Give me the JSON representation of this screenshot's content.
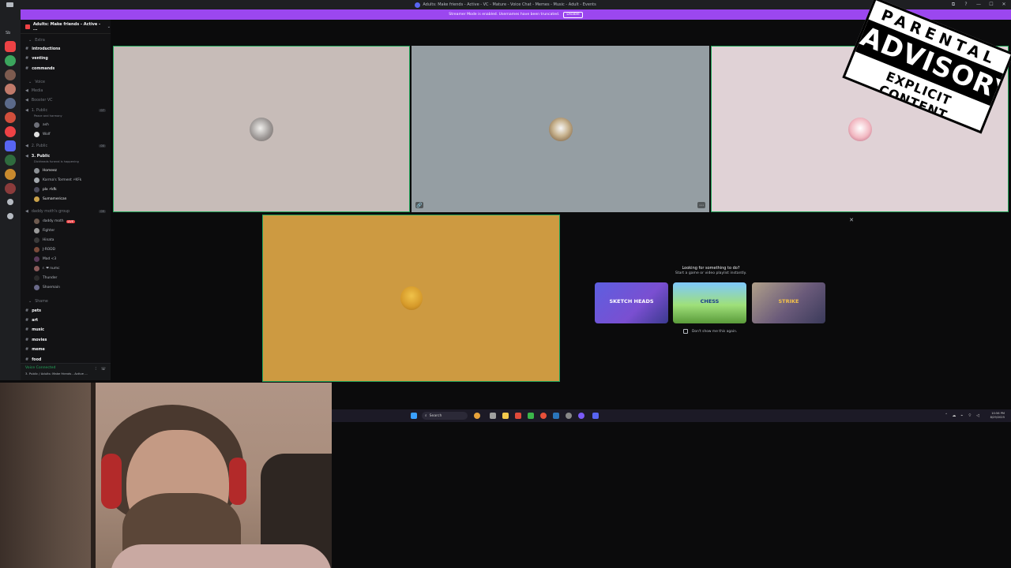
{
  "window": {
    "title": "Adults: Make friends - Active - VC - Mature - Voice Chat - Memes - Music - Adult - Events",
    "controls": [
      "⧉",
      "?",
      "—",
      "☐",
      "✕"
    ]
  },
  "banner": {
    "text": "Streamer Mode is enabled. Usernames have been truncated.",
    "disable_label": "Disable"
  },
  "rail": {
    "label": "Sb"
  },
  "server": {
    "name": "Adults: Make friends - Active - ...",
    "channels_top": [
      {
        "label": "Extra",
        "type": "category"
      },
      {
        "label": "introductions",
        "type": "text",
        "bright": true
      },
      {
        "label": "venting",
        "type": "text",
        "bright": true
      },
      {
        "label": "commands",
        "type": "text",
        "bright": true
      },
      {
        "label": "Voice",
        "type": "category"
      },
      {
        "label": "Media",
        "type": "voice"
      },
      {
        "label": "Booster VC",
        "type": "voice"
      },
      {
        "label": "1. Public",
        "type": "voice"
      }
    ],
    "public1_topic": "Peace and harmony",
    "public1_users": [
      "ash",
      "Wolf"
    ],
    "public2": "2. Public",
    "public3": "3. Public",
    "public3_topic": "Dickheads funeral is happening",
    "public3_users": [
      "Homeez",
      "Karma's Torment ⚡KFk",
      "plx ⚡kfk",
      "Sumamerican"
    ],
    "daddy_group": "daddy moth's group",
    "daddy_users": [
      "daddy moth",
      "Fighter",
      "Hinata",
      "J-RODD",
      "Mad <3",
      "r. ❤ numc",
      "Thunder",
      "Shoemain"
    ],
    "live_label": "LIVE",
    "shame_category": "Shame",
    "text_channels": [
      "pets",
      "art",
      "music",
      "movies",
      "meme",
      "food"
    ],
    "counts": {
      "public1": "07",
      "public2": "00",
      "daddy": "09"
    },
    "voice_status": "Voice Connected",
    "voice_sub": "3. Public / Adults: Make friends - Active ..."
  },
  "tiles": {
    "corner_icon_left": "🔗",
    "corner_icon_right": "⋯"
  },
  "activity": {
    "title": "Looking for something to do?",
    "subtitle": "Start a game or video playlist instantly.",
    "games": [
      "SKETCH HEADS",
      "CHESS",
      "STRIKE"
    ],
    "dont_show": "Don't show me this again."
  },
  "sticker": {
    "line1": "PARENTAL",
    "line2": "ADVISORY",
    "line3": "EXPLICIT CONTENT"
  },
  "taskbar": {
    "search_label": "Search",
    "time": "10:56 PM",
    "date": "8/29/2025"
  },
  "colors": {
    "banner": "#9b47ef",
    "speaking_border": "#23a55a",
    "tile1_bg": "#c7bcb8",
    "tile2_bg": "#959ea3",
    "tile3_bg": "#e0d2d6",
    "tile4_bg": "#cd9a41"
  }
}
